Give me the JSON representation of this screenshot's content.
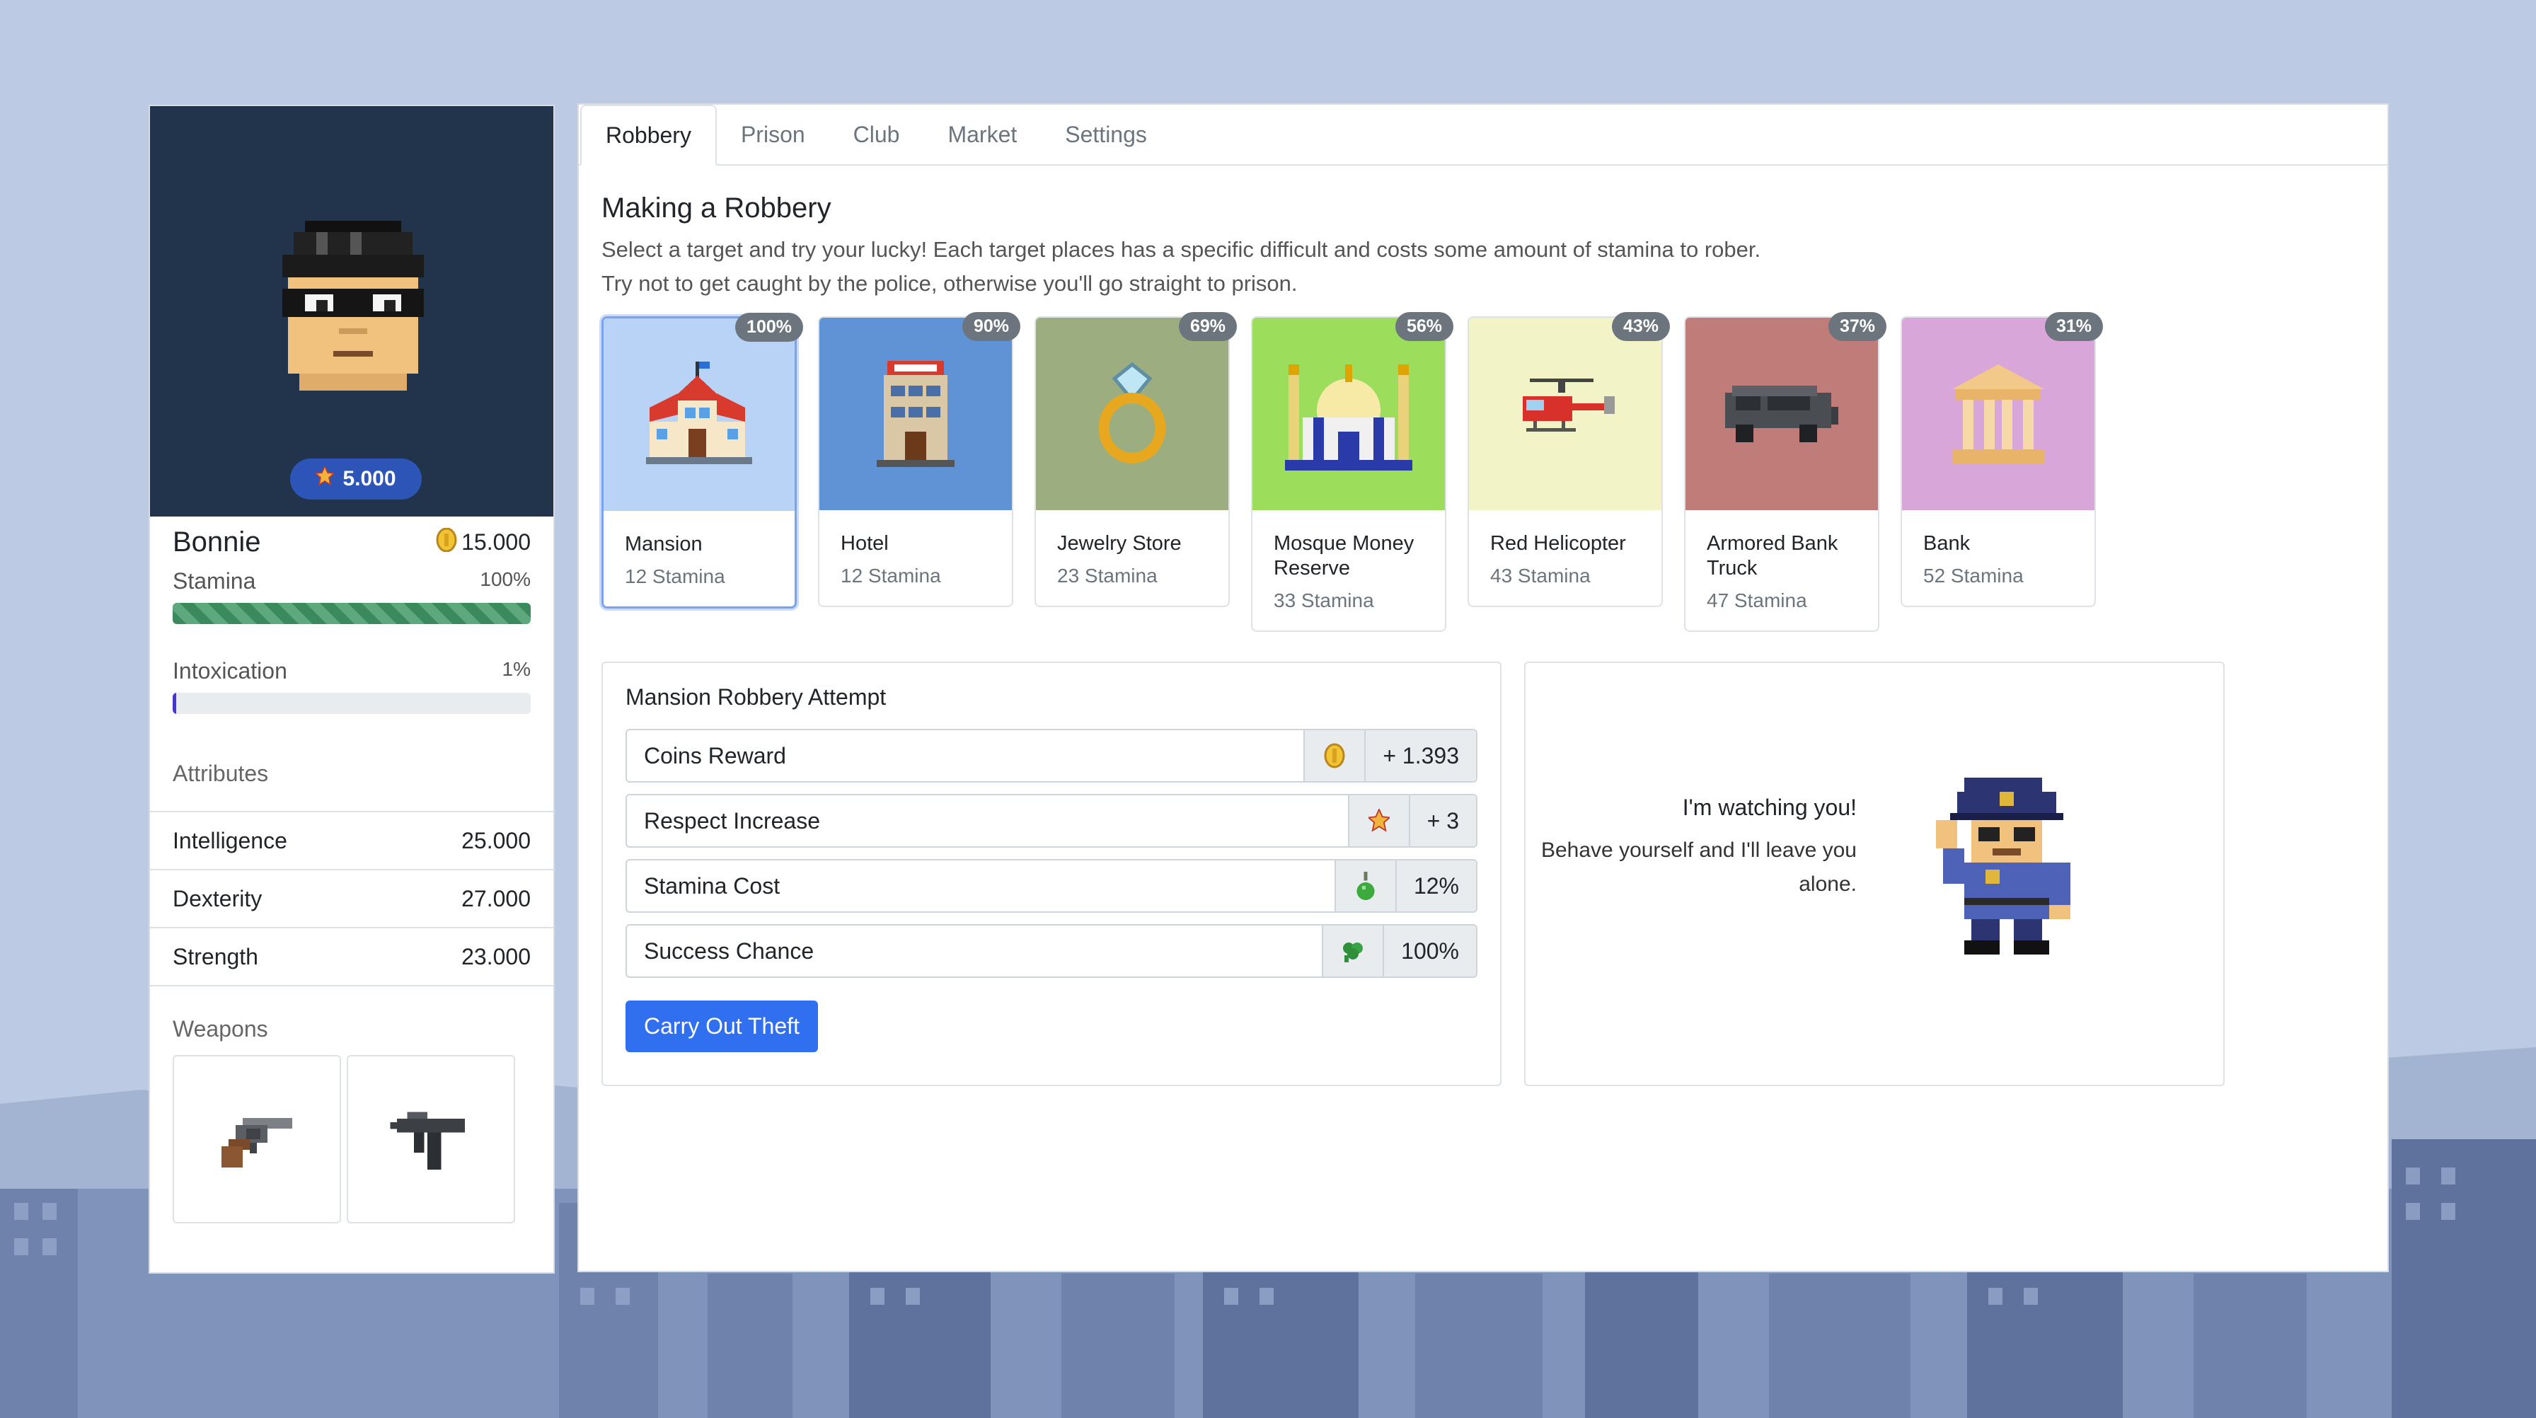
{
  "player": {
    "name": "Bonnie",
    "respect": "5.000",
    "coins": "15.000",
    "stamina_label": "Stamina",
    "stamina_value": "100%",
    "stamina_level": 1.0,
    "intox_label": "Intoxication",
    "intox_value": "1%",
    "intox_level": 0.01,
    "attributes_title": "Attributes",
    "attributes": [
      {
        "label": "Intelligence",
        "value": "25.000"
      },
      {
        "label": "Dexterity",
        "value": "27.000"
      },
      {
        "label": "Strength",
        "value": "23.000"
      }
    ],
    "weapons_title": "Weapons",
    "weapons": [
      "revolver-icon",
      "uzi-icon"
    ]
  },
  "tabs": [
    "Robbery",
    "Prison",
    "Club",
    "Market",
    "Settings"
  ],
  "active_tab": "Robbery",
  "robbery": {
    "title": "Making a Robbery",
    "desc1": "Select a target and try your lucky! Each target places has a specific difficult and costs some amount of stamina to rober.",
    "desc2": "Try not to get caught by the police, otherwise you'll go straight to prison.",
    "targets": [
      {
        "name": "Mansion",
        "stamina": "12 Stamina",
        "chance": "100%",
        "color": "#b9d3f7",
        "icon": "mansion-icon"
      },
      {
        "name": "Hotel",
        "stamina": "12 Stamina",
        "chance": "90%",
        "color": "#5f93d6",
        "icon": "hotel-icon"
      },
      {
        "name": "Jewelry Store",
        "stamina": "23 Stamina",
        "chance": "69%",
        "color": "#9cae80",
        "icon": "ring-icon"
      },
      {
        "name": "Mosque Money Reserve",
        "stamina": "33 Stamina",
        "chance": "56%",
        "color": "#9cde5c",
        "icon": "mosque-icon"
      },
      {
        "name": "Red Helicopter",
        "stamina": "43 Stamina",
        "chance": "43%",
        "color": "#f2f4c8",
        "icon": "helicopter-icon"
      },
      {
        "name": "Armored Bank Truck",
        "stamina": "47 Stamina",
        "chance": "37%",
        "color": "#c07c78",
        "icon": "truck-icon"
      },
      {
        "name": "Bank",
        "stamina": "52 Stamina",
        "chance": "31%",
        "color": "#d8a6d8",
        "icon": "bank-icon"
      }
    ],
    "attempt_title": "Mansion Robbery Attempt",
    "rows": [
      {
        "label": "Coins Reward",
        "value": "+ 1.393",
        "icon": "coin-icon"
      },
      {
        "label": "Respect Increase",
        "value": "+ 3",
        "icon": "respect-icon"
      },
      {
        "label": "Stamina Cost",
        "value": "12%",
        "icon": "potion-icon"
      },
      {
        "label": "Success Chance",
        "value": "100%",
        "icon": "clover-icon"
      }
    ],
    "button": "Carry Out Theft",
    "cop_title": "I'm watching you!",
    "cop_msg": "Behave yourself and I'll leave you alone."
  }
}
